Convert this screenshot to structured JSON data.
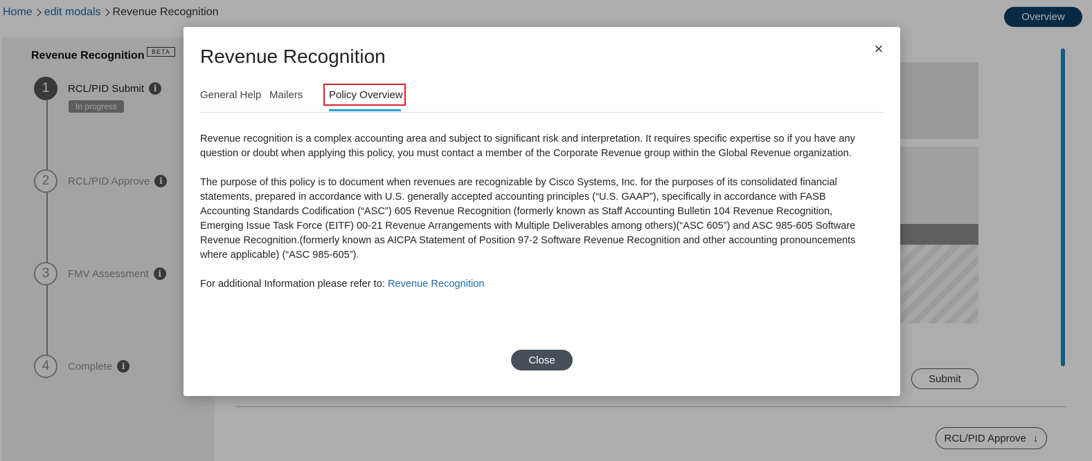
{
  "breadcrumb": {
    "home": "Home",
    "parent": "edit modals",
    "current": "Revenue Recognition"
  },
  "header": {
    "overview_label": "Overview"
  },
  "wizard": {
    "title": "Revenue Recognition",
    "badge": "BETA",
    "steps": [
      {
        "number": "1",
        "label": "RCL/PID Submit",
        "status": "In progress"
      },
      {
        "number": "2",
        "label": "RCL/PID Approve"
      },
      {
        "number": "3",
        "label": "FMV Assessment"
      },
      {
        "number": "4",
        "label": "Complete"
      }
    ]
  },
  "main": {
    "submit_label": "Submit",
    "next_step_label": "RCL/PID Approve"
  },
  "modal": {
    "title": "Revenue Recognition",
    "close_icon": "×",
    "tabs": [
      "General Help",
      "Mailers",
      "Policy Overview"
    ],
    "active_tab": "Policy Overview",
    "paragraphs": [
      "Revenue recognition is a complex accounting area and subject to significant risk and interpretation. It requires specific expertise so if you have any question or doubt when applying this policy, you must contact a member of the Corporate Revenue group within the Global Revenue organization.",
      "The purpose of this policy is to document when revenues are recognizable by Cisco Systems, Inc. for the purposes of its consolidated financial statements, prepared in accordance with U.S. generally accepted accounting principles (“U.S. GAAP”), specifically in accordance with FASB Accounting Standards Codification (“ASC”) 605 Revenue Recognition (formerly known as Staff Accounting Bulletin 104 Revenue Recognition, Emerging Issue Task Force (EITF) 00-21 Revenue Arrangements with Multiple Deliverables among others)(“ASC 605”) and ASC 985-605 Software Revenue Recognition.(formerly known as AICPA Statement of Position 97-2 Software Revenue Recognition and other accounting pronouncements where applicable) (“ASC 985-605”)."
    ],
    "additional_info_prefix": "For additional Information please refer to: ",
    "additional_info_link": "Revenue Recognition",
    "close_label": "Close"
  },
  "icons": {
    "info": "i",
    "arrow_down": "↓"
  },
  "colors": {
    "accent": "#1fa6d8",
    "link": "#1d69a8",
    "highlight_outline": "#d81f2a",
    "primary_dark": "#0d3e66",
    "close_button": "#46505a"
  }
}
